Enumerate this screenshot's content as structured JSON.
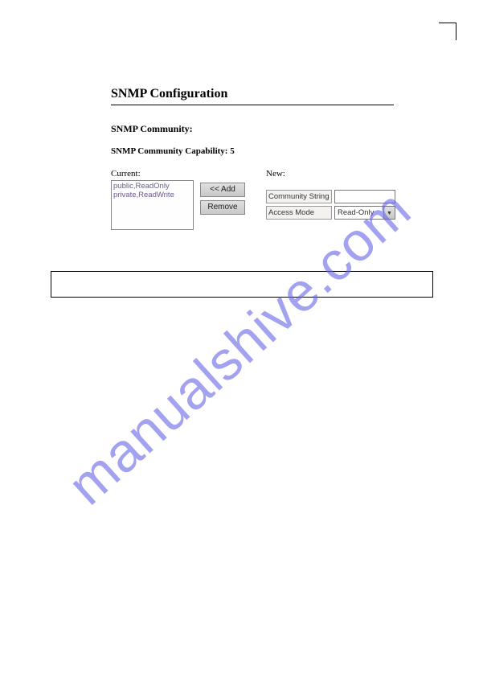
{
  "page": {
    "title": "SNMP Configuration",
    "section_heading": "SNMP Community:",
    "capability_text": "SNMP Community Capability: 5"
  },
  "form": {
    "current_label": "Current:",
    "new_label": "New:",
    "listbox_items": [
      "public,ReadOnly",
      "private,ReadWrite"
    ],
    "add_button": "<< Add",
    "remove_button": "Remove",
    "field_cs": "Community String",
    "field_am": "Access Mode",
    "cs_value": "",
    "am_value": "Read-Only"
  },
  "watermark": "manualshive.com"
}
